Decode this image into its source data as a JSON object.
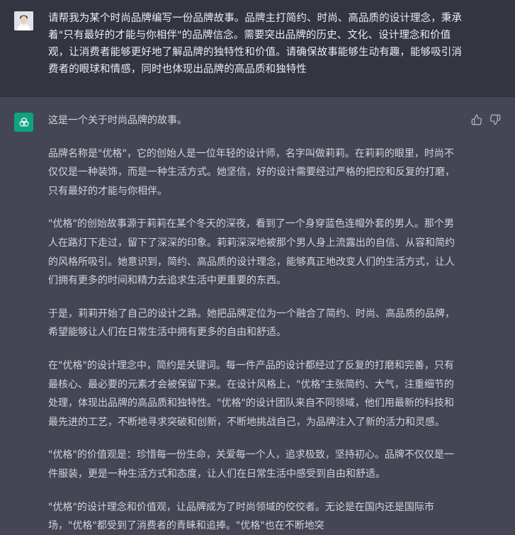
{
  "conversation": {
    "user_message": "请帮我为某个时尚品牌编写一份品牌故事。品牌主打简约、时尚、高品质的设计理念，秉承着\"只有最好的才能与你相伴\"的品牌信念。需要突出品牌的历史、文化、设计理念和价值观，让消费者能够更好地了解品牌的独特性和价值。请确保故事能够生动有趣，能够吸引消费者的眼球和情感，同时也体现出品牌的高品质和独特性",
    "assistant_paragraphs": [
      "这是一个关于时尚品牌的故事。",
      "品牌名称是\"优格\"，它的创始人是一位年轻的设计师，名字叫做莉莉。在莉莉的眼里，时尚不仅仅是一种装饰，而是一种生活方式。她坚信，好的设计需要经过严格的把控和反复的打磨，只有最好的才能与你相伴。",
      "\"优格\"的创始故事源于莉莉在某个冬天的深夜，看到了一个身穿蓝色连帽外套的男人。那个男人在路灯下走过，留下了深深的印象。莉莉深深地被那个男人身上流露出的自信、从容和简约的风格所吸引。她意识到，简约、高品质的设计理念，能够真正地改变人们的生活方式，让人们拥有更多的时间和精力去追求生活中更重要的东西。",
      "于是，莉莉开始了自己的设计之路。她把品牌定位为一个融合了简约、时尚、高品质的品牌，希望能够让人们在日常生活中拥有更多的自由和舒适。",
      "在\"优格\"的设计理念中，简约是关键词。每一件产品的设计都经过了反复的打磨和完善，只有最核心、最必要的元素才会被保留下来。在设计风格上，\"优格\"主张简约、大气，注重细节的处理，体现出品牌的高品质和独特性。\"优格\"的设计团队来自不同领域，他们用最新的科技和最先进的工艺，不断地寻求突破和创新，不断地挑战自己，为品牌注入了新的活力和灵感。",
      "\"优格\"的价值观是：珍惜每一份生命，关爱每一个人，追求极致，坚持初心。品牌不仅仅是一件服装，更是一种生活方式和态度，让人们在日常生活中感受到自由和舒适。",
      "\"优格\"的设计理念和价值观，让品牌成为了时尚领域的佼佼者。无论是在国内还是国际市场，\"优格\"都受到了消费者的青睐和追捧。\"优格\"也在不断地突"
    ]
  },
  "icons": {
    "user_avatar": "user-avatar-photo",
    "assistant_avatar": "openai-logo-icon",
    "thumbs_up": "thumbs-up-icon",
    "thumbs_down": "thumbs-down-icon"
  },
  "colors": {
    "user_bg": "#343541",
    "assistant_bg": "#444654",
    "accent": "#10a37f",
    "text": "#d1d5db"
  }
}
